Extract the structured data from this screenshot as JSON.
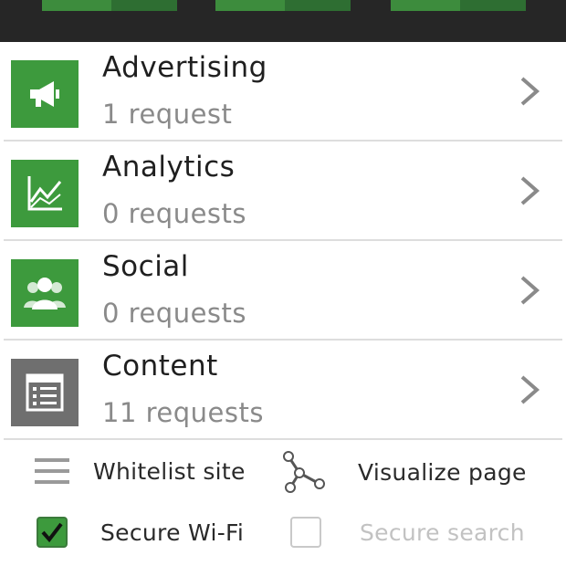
{
  "categories": [
    {
      "title": "Advertising",
      "count": "1 request",
      "icon": "megaphone-icon",
      "color": "#3d9a3d"
    },
    {
      "title": "Analytics",
      "count": "0 requests",
      "icon": "chart-icon",
      "color": "#3d9a3d"
    },
    {
      "title": "Social",
      "count": "0 requests",
      "icon": "people-icon",
      "color": "#3d9a3d"
    },
    {
      "title": "Content",
      "count": "11 requests",
      "icon": "document-list-icon",
      "color": "#6f6f6f"
    }
  ],
  "footer": {
    "whitelist_label": "Whitelist site",
    "visualize_label": "Visualize page",
    "secure_wifi_label": "Secure Wi-Fi",
    "secure_search_label": "Secure search",
    "secure_wifi_checked": true,
    "secure_search_checked": false
  },
  "colors": {
    "accent_green": "#3d9a3d",
    "topbar": "#262626",
    "content_gray": "#6f6f6f"
  }
}
